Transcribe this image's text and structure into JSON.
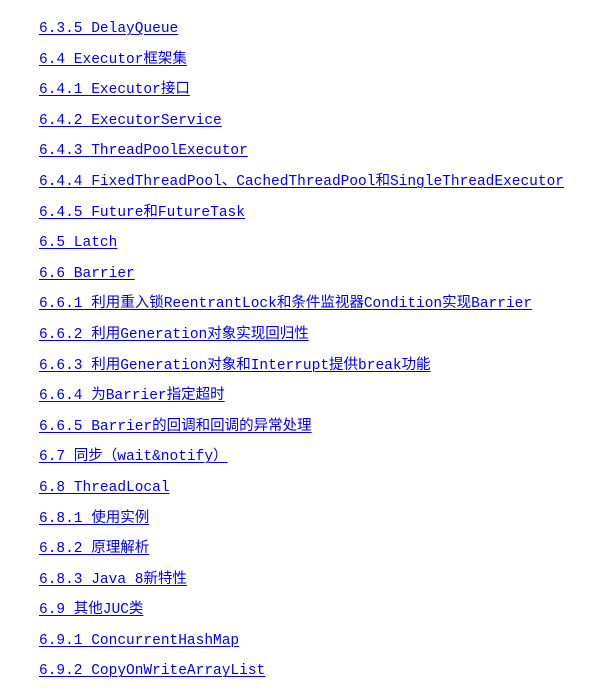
{
  "document": {
    "type": "table-of-contents",
    "chapter": "6",
    "background_color": "#ffffff",
    "link_color": "#0000ee",
    "link_style": "underline"
  },
  "toc": {
    "entries": [
      {
        "number": "6.3.5",
        "title": "DelayQueue",
        "text": "6.3.5 DelayQueue",
        "level": 3
      },
      {
        "number": "6.4",
        "title": "Executor框架集",
        "text": "6.4 Executor框架集",
        "level": 2
      },
      {
        "number": "6.4.1",
        "title": "Executor接口",
        "text": "6.4.1 Executor接口",
        "level": 3
      },
      {
        "number": "6.4.2",
        "title": "ExecutorService",
        "text": "6.4.2 ExecutorService",
        "level": 3
      },
      {
        "number": "6.4.3",
        "title": "ThreadPoolExecutor",
        "text": "6.4.3 ThreadPoolExecutor",
        "level": 3
      },
      {
        "number": "6.4.4",
        "title": "FixedThreadPool、CachedThreadPool和SingleThreadExecutor",
        "text": "6.4.4 FixedThreadPool、CachedThreadPool和SingleThreadExecutor",
        "level": 3
      },
      {
        "number": "6.4.5",
        "title": "Future和FutureTask",
        "text": "6.4.5 Future和FutureTask",
        "level": 3
      },
      {
        "number": "6.5",
        "title": "Latch",
        "text": "6.5 Latch",
        "level": 2
      },
      {
        "number": "6.6",
        "title": "Barrier",
        "text": "6.6 Barrier",
        "level": 2
      },
      {
        "number": "6.6.1",
        "title": "利用重入锁ReentrantLock和条件监视器Condition实现Barrier",
        "text": "6.6.1 利用重入锁ReentrantLock和条件监视器Condition实现Barrier",
        "level": 3
      },
      {
        "number": "6.6.2",
        "title": "利用Generation对象实现回归性",
        "text": "6.6.2 利用Generation对象实现回归性",
        "level": 3
      },
      {
        "number": "6.6.3",
        "title": "利用Generation对象和Interrupt提供break功能",
        "text": "6.6.3 利用Generation对象和Interrupt提供break功能",
        "level": 3
      },
      {
        "number": "6.6.4",
        "title": "为Barrier指定超时",
        "text": "6.6.4 为Barrier指定超时",
        "level": 3
      },
      {
        "number": "6.6.5",
        "title": "Barrier的回调和回调的异常处理",
        "text": "6.6.5 Barrier的回调和回调的异常处理",
        "level": 3
      },
      {
        "number": "6.7",
        "title": "同步（wait&notify）",
        "text": "6.7 同步（wait&notify）",
        "level": 2
      },
      {
        "number": "6.8",
        "title": "ThreadLocal",
        "text": "6.8 ThreadLocal",
        "level": 2
      },
      {
        "number": "6.8.1",
        "title": "使用实例",
        "text": "6.8.1 使用实例",
        "level": 3
      },
      {
        "number": "6.8.2",
        "title": "原理解析",
        "text": "6.8.2 原理解析",
        "level": 3
      },
      {
        "number": "6.8.3",
        "title": "Java 8新特性",
        "text": "6.8.3 Java 8新特性",
        "level": 3
      },
      {
        "number": "6.9",
        "title": "其他JUC类",
        "text": "6.9 其他JUC类",
        "level": 2
      },
      {
        "number": "6.9.1",
        "title": "ConcurrentHashMap",
        "text": "6.9.1 ConcurrentHashMap",
        "level": 3
      },
      {
        "number": "6.9.2",
        "title": "CopyOnWriteArrayList",
        "text": "6.9.2 CopyOnWriteArrayList",
        "level": 3
      }
    ]
  }
}
